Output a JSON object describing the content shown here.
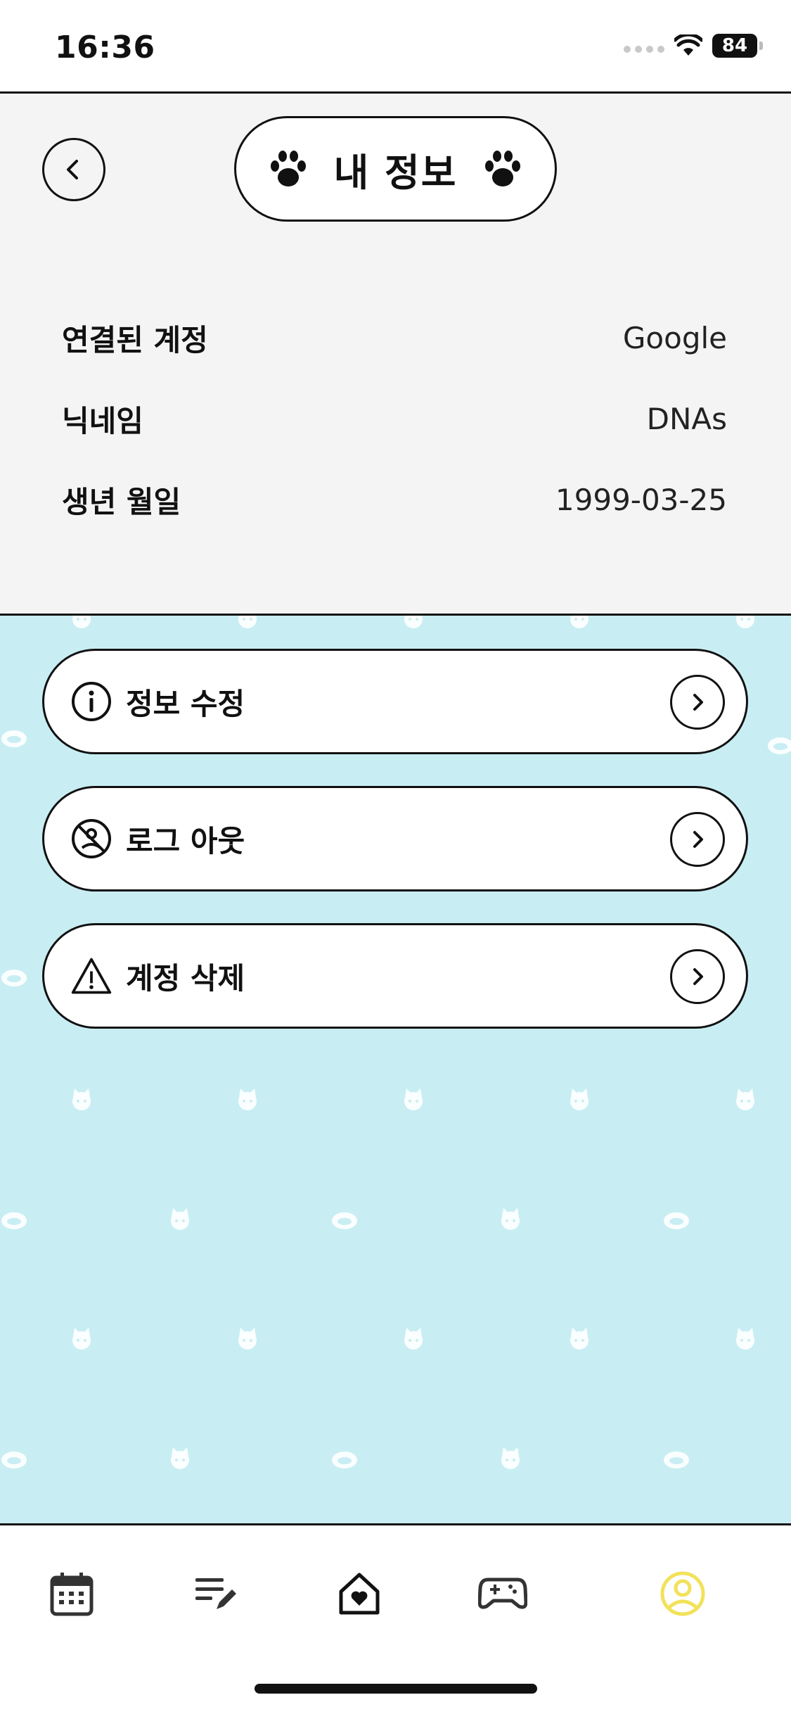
{
  "status_bar": {
    "time": "16:36",
    "battery": "84"
  },
  "header": {
    "title": "내 정보"
  },
  "info": [
    {
      "label": "연결된 계정",
      "value": "Google"
    },
    {
      "label": "닉네임",
      "value": "DNAs"
    },
    {
      "label": "생년 월일",
      "value": "1999-03-25"
    }
  ],
  "menu": [
    {
      "label": "정보 수정",
      "icon": "info-icon"
    },
    {
      "label": "로그 아웃",
      "icon": "logout-icon"
    },
    {
      "label": "계정 삭제",
      "icon": "warning-icon"
    }
  ],
  "bottom_nav": {
    "items": [
      "calendar-icon",
      "edit-list-icon",
      "home-heart-icon",
      "gamepad-icon",
      "profile-icon"
    ],
    "active": "profile-icon",
    "active_color": "#f2e25a"
  },
  "colors": {
    "content_bg": "#c8eef3",
    "panel_bg": "#f4f4f4"
  }
}
